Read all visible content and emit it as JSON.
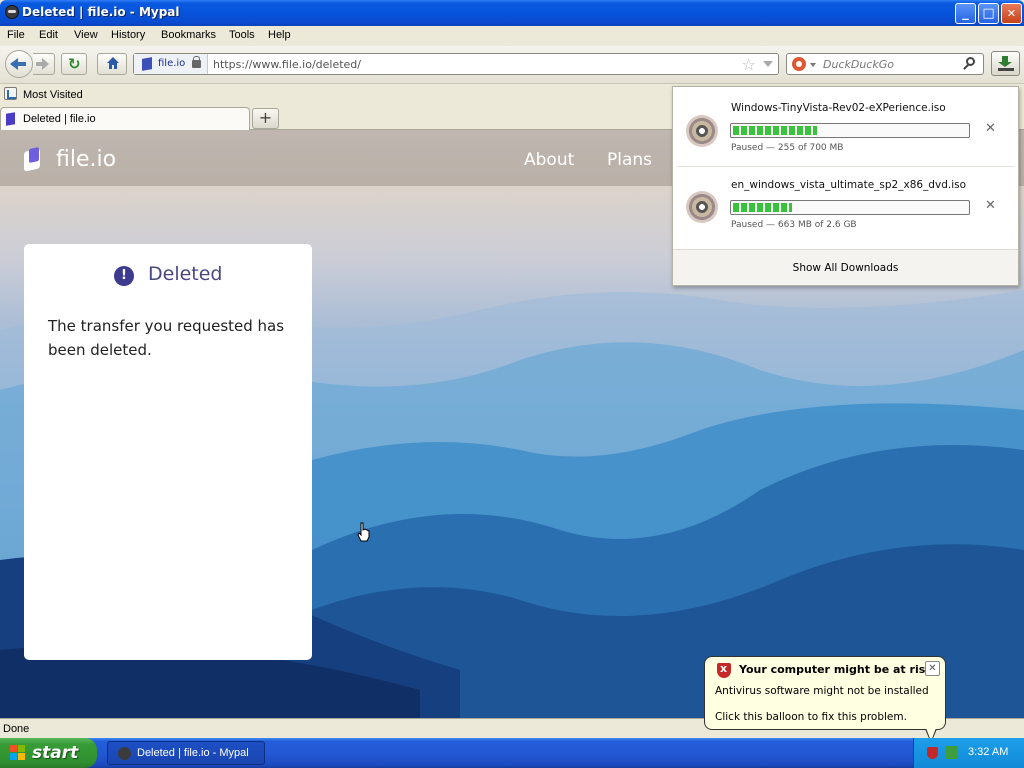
{
  "window": {
    "title": "Deleted | file.io - Mypal",
    "minimize": "_",
    "maximize": "□",
    "close": "✕"
  },
  "menu": [
    "File",
    "Edit",
    "View",
    "History",
    "Bookmarks",
    "Tools",
    "Help"
  ],
  "navbar": {
    "identity_site": "file.io",
    "url": "https://www.file.io/deleted/",
    "search_placeholder": "DuckDuckGo",
    "reload_glyph": "↻",
    "star_glyph": "☆"
  },
  "bookmarks": {
    "most_visited": "Most Visited"
  },
  "tabs": [
    {
      "label": "Deleted | file.io"
    }
  ],
  "new_tab_glyph": "+",
  "site": {
    "logo_text": "file.io",
    "nav": [
      "About",
      "Plans"
    ],
    "card": {
      "alert_glyph": "!",
      "heading": "Deleted",
      "message": "The transfer you requested has been deleted."
    }
  },
  "downloads": {
    "items": [
      {
        "name": "Windows-TinyVista-Rev02-eXPerience.iso",
        "status": "Paused — 255 of 700 MB",
        "progress": 0.36
      },
      {
        "name": "en_windows_vista_ultimate_sp2_x86_dvd.iso",
        "status": "Paused — 663 MB of 2.6 GB",
        "progress": 0.25
      }
    ],
    "show_all": "Show All Downloads",
    "remove_glyph": "✕"
  },
  "statusbar": {
    "text": "Done"
  },
  "balloon": {
    "title": "Your computer might be at risk",
    "line1": "Antivirus software might not be installed",
    "line2": "Click this balloon to fix this problem.",
    "close_glyph": "✕"
  },
  "taskbar": {
    "start": "start",
    "task_label": "Deleted | file.io - Mypal",
    "clock": "3:32 AM"
  },
  "icons": {
    "app": "mypal-icon",
    "back": "back-arrow-icon",
    "forward": "forward-arrow-icon",
    "reload": "reload-icon",
    "home": "home-icon",
    "lock": "lock-icon",
    "bookmark_star": "star-icon",
    "search": "magnifier-icon",
    "download": "download-icon",
    "disc": "disc-icon",
    "shield": "security-shield-icon"
  },
  "colors": {
    "titlebar": "#0654dc",
    "progress": "#37c43a",
    "balloon": "#ffffe1",
    "start": "#379d37",
    "card_heading": "#4a4880"
  }
}
